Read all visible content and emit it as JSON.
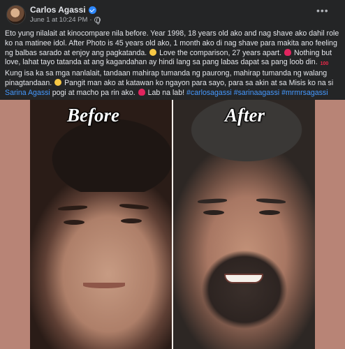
{
  "post": {
    "author": "Carlos Agassi",
    "date": "June 1 at 10:24 PM",
    "dot": "·",
    "more_glyph": "•••"
  },
  "caption": {
    "p1": "Eto yung nilalait at kinocompare nila before. Year 1998, 18 years old ako and nag shave ako dahil role ko na matinee idol. After Photo is 45 years old ako, 1 month ako di nag shave para makita ano feeling ng balbas sarado at enjoy ang pagkatanda.",
    "p2": "Love the comparison, 27 years apart.",
    "p3": "Nothing but love, lahat tayo tatanda at ang kagandahan ay hindi lang sa pang labas dapat sa pang loob din.",
    "p4": "Kung isa ka sa mga nanlalait, tandaan mahirap tumanda ng paurong, mahirap tumanda ng walang pinagtandaan.",
    "p5": "Pangit man ako at katawan ko ngayon para sayo, para sa akin at sa Misis ko na si",
    "mention": "Sarina Agassi",
    "p6": "pogi at macho pa rin ako.",
    "p7": "Lab na lab!",
    "tags": [
      "#carlosagassi",
      "#sarinaagassi",
      "#mrmrsagassi"
    ],
    "emoji": {
      "smile": "smiling-face",
      "heart": "red-heart",
      "hundred": "100"
    }
  },
  "image": {
    "before_label": "Before",
    "after_label": "After"
  },
  "colors": {
    "background": "#242526",
    "text": "#e4e6eb",
    "link": "#4599ff",
    "verified": "#2d88ff",
    "media_bg": "#b88476"
  }
}
